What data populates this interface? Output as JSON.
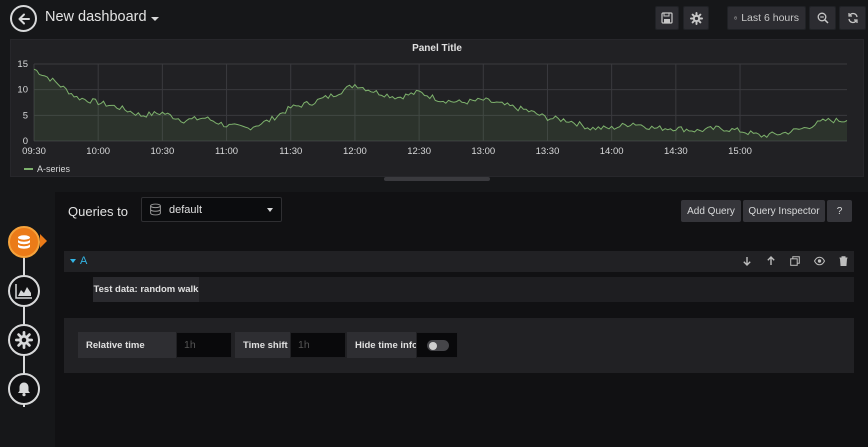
{
  "header": {
    "dashboard_title": "New dashboard",
    "time_range": "Last 6 hours",
    "icons": [
      "arrow-left-icon",
      "save-icon",
      "gear-icon",
      "clock-icon",
      "zoom-out-icon",
      "refresh-icon"
    ]
  },
  "panel": {
    "title": "Panel Title",
    "legend": [
      {
        "name": "A-series",
        "color": "#7eb26d"
      }
    ]
  },
  "chart_data": {
    "type": "area",
    "title": "Panel Title",
    "x_tick_labels": [
      "09:30",
      "10:00",
      "10:30",
      "11:00",
      "11:30",
      "12:00",
      "12:30",
      "13:00",
      "13:30",
      "14:00",
      "14:30",
      "15:00"
    ],
    "y_tick_labels": [
      "0",
      "5",
      "10",
      "15"
    ],
    "ylim": [
      0,
      15
    ],
    "xlim": [
      "09:30",
      "15:50"
    ],
    "grid": true,
    "legend_position": "bottom-left",
    "series": [
      {
        "name": "A-series",
        "color": "#7eb26d",
        "x": [
          "09:30",
          "09:40",
          "09:50",
          "10:00",
          "10:10",
          "10:20",
          "10:30",
          "10:40",
          "10:50",
          "11:00",
          "11:10",
          "11:20",
          "11:30",
          "11:40",
          "11:50",
          "12:00",
          "12:10",
          "12:20",
          "12:30",
          "12:40",
          "12:50",
          "13:00",
          "13:10",
          "13:20",
          "13:30",
          "13:40",
          "13:50",
          "14:00",
          "14:10",
          "14:20",
          "14:30",
          "14:40",
          "14:50",
          "15:00",
          "15:10",
          "15:20",
          "15:30",
          "15:40",
          "15:50"
        ],
        "y": [
          14,
          11.5,
          8.5,
          7.5,
          6.5,
          5,
          5.5,
          4,
          4.5,
          3,
          2.5,
          4,
          6.5,
          7.5,
          9,
          11,
          9.5,
          8.5,
          9.5,
          8,
          7.5,
          8,
          7,
          6,
          4.5,
          4,
          2.5,
          2.5,
          3.5,
          2.5,
          2.5,
          2,
          2.5,
          2,
          1,
          1.5,
          2.5,
          4,
          4
        ]
      }
    ]
  },
  "editor": {
    "queries_label": "Queries to",
    "datasource": "default",
    "add_query_label": "Add Query",
    "query_inspector_label": "Query Inspector",
    "help_label": "?",
    "query": {
      "ref_id": "A",
      "scenario": "Test data: random walk",
      "row_icons": [
        "arrow-down-icon",
        "arrow-up-icon",
        "copy-icon",
        "eye-icon",
        "trash-icon"
      ]
    },
    "options": {
      "relative_time_label": "Relative time",
      "relative_time_placeholder": "1h",
      "time_shift_label": "Time shift",
      "time_shift_placeholder": "1h",
      "hide_time_info_label": "Hide time info",
      "hide_time_info_enabled": false
    }
  },
  "sidebar": {
    "steps": [
      "database-icon",
      "area-chart-icon",
      "settings-icon",
      "bell-icon"
    ],
    "active_step": "database-icon"
  },
  "colors": {
    "background": "#161719",
    "panel": "#212124",
    "accent": "#eb7b18",
    "series": "#7eb26d",
    "link": "#33b5e5"
  }
}
